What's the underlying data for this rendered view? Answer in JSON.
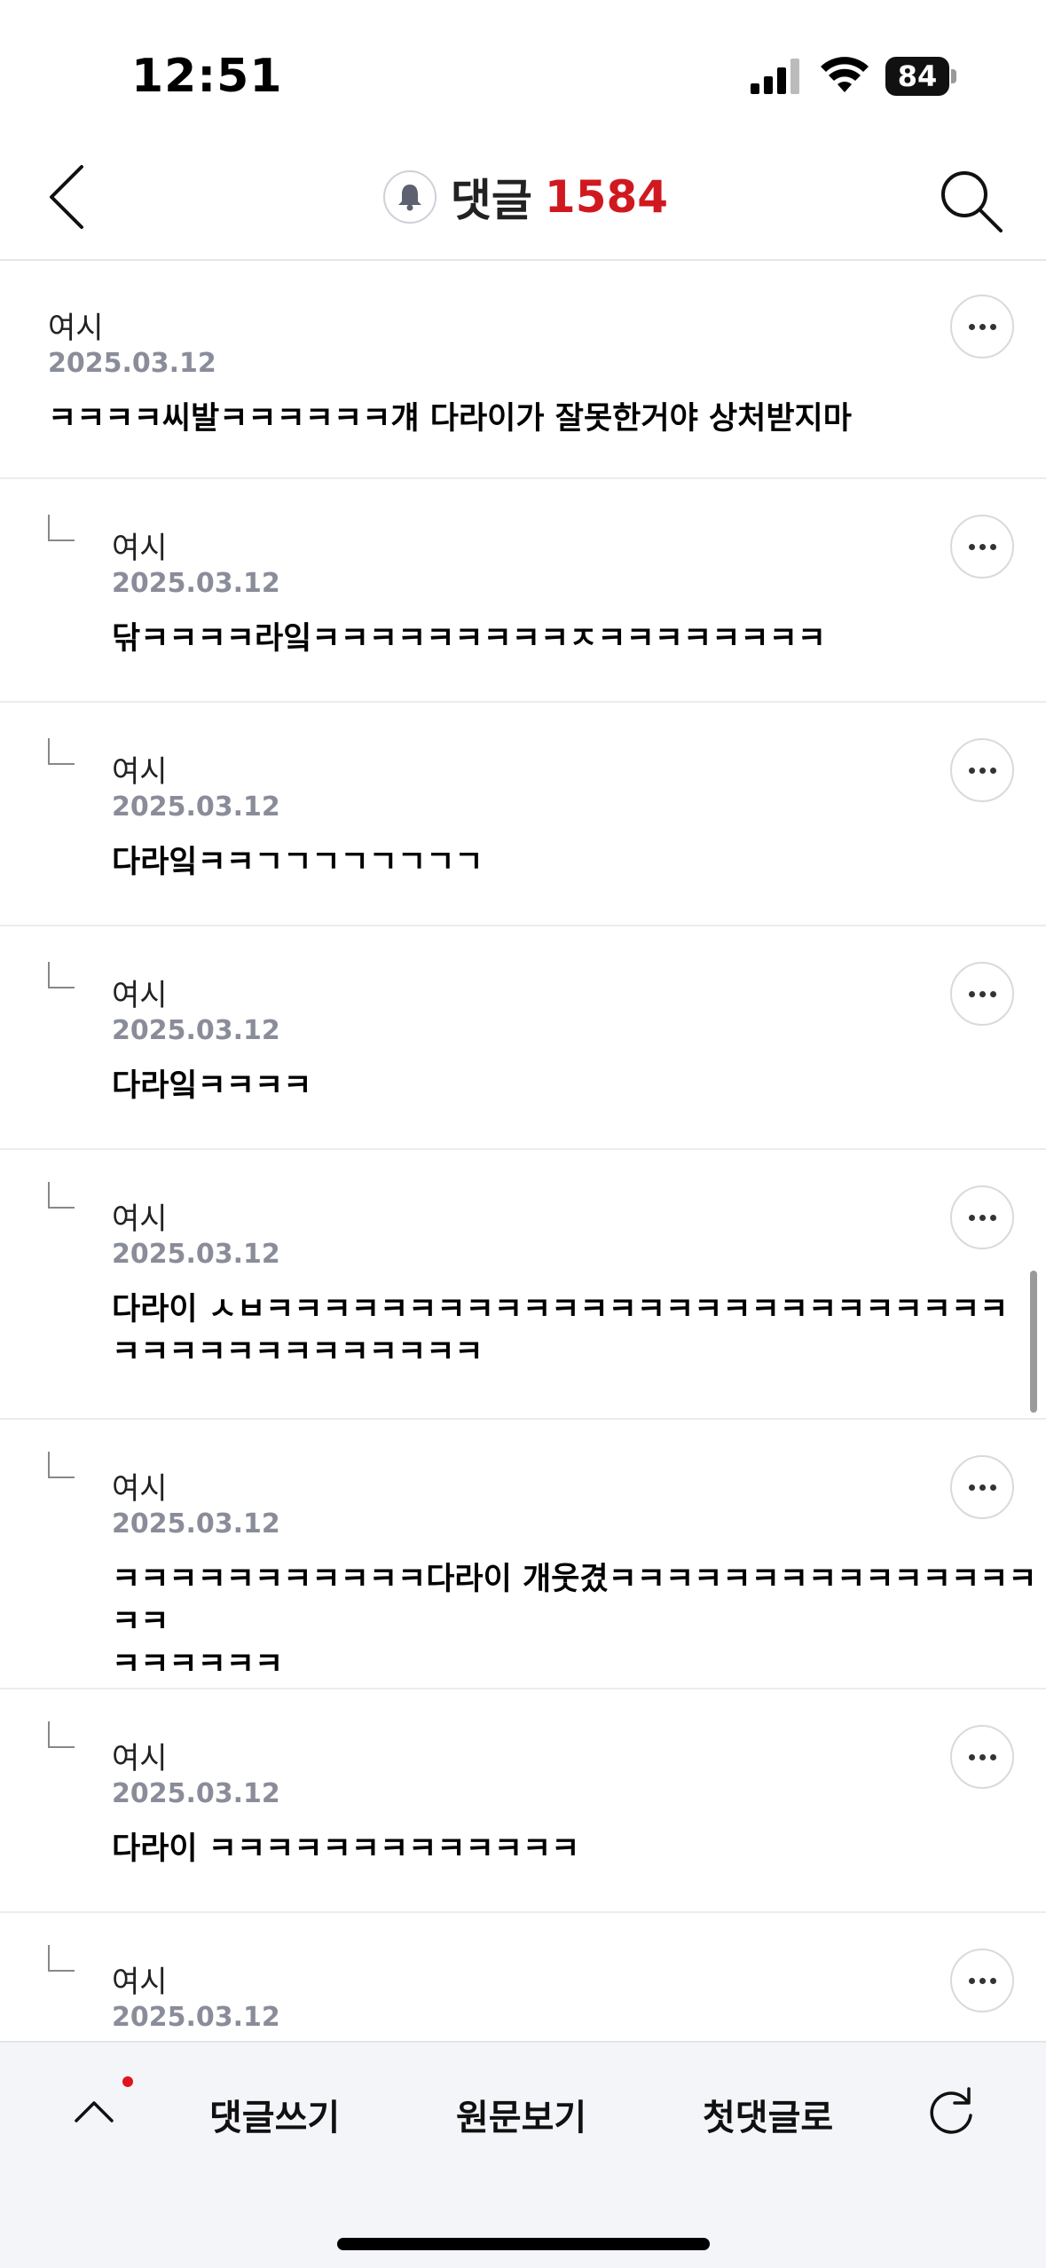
{
  "status_bar": {
    "time": "12:51",
    "battery": "84",
    "icons": [
      "signal-icon",
      "wifi-icon",
      "battery-icon"
    ]
  },
  "header": {
    "title": "댓글",
    "count": "1584",
    "count_color": "#d0191f",
    "icons": [
      "back-arrow-icon",
      "bell-icon",
      "search-icon"
    ]
  },
  "comments": [
    {
      "author": "여시",
      "date": "2025.03.12",
      "lines": [
        "ㅋㅋㅋㅋ씨발ㅋㅋㅋㅋㅋㅋ걔 다라이가 잘못한거야 상처받지마"
      ],
      "reply": false
    },
    {
      "author": "여시",
      "date": "2025.03.12",
      "lines": [
        "닦ㅋㅋㅋㅋ라잌ㅋㅋㅋㅋㅋㅋㅋㅋㅋㅈㅋㅋㅋㅋㅋㅋㅋㅋ"
      ],
      "reply": true
    },
    {
      "author": "여시",
      "date": "2025.03.12",
      "lines": [
        "다라잌ㅋㅋㄱㄱㄱㄱㄱㄱㄱㄱ"
      ],
      "reply": true
    },
    {
      "author": "여시",
      "date": "2025.03.12",
      "lines": [
        "다라잌ㅋㅋㅋㅋ"
      ],
      "reply": true
    },
    {
      "author": "여시",
      "date": "2025.03.12",
      "lines": [
        "다라이 ㅅㅂㅋㅋㅋㅋㅋㅋㅋㅋㅋㅋㅋㅋㅋㅋㅋㅋㅋㅋㅋㅋㅋㅋㅋㅋㅋㅋ",
        "ㅋㅋㅋㅋㅋㅋㅋㅋㅋㅋㅋㅋㅋ"
      ],
      "reply": true
    },
    {
      "author": "여시",
      "date": "2025.03.12",
      "lines": [
        "ㅋㅋㅋㅋㅋㅋㅋㅋㅋㅋㅋ다라이 개웃겼ㅋㅋㅋㅋㅋㅋㅋㅋㅋㅋㅋㅋㅋㅋㅋㅋㅋ",
        "ㅋㅋㅋㅋㅋㅋ"
      ],
      "reply": true
    },
    {
      "author": "여시",
      "date": "2025.03.12",
      "lines": [
        "다라이 ㅋㅋㅋㅋㅋㅋㅋㅋㅋㅋㅋㅋㅋ"
      ],
      "reply": true
    },
    {
      "author": "여시",
      "date": "2025.03.12",
      "lines": [],
      "reply": true
    }
  ],
  "bottom_bar": {
    "write_comment": "댓글쓰기",
    "view_original": "원문보기",
    "first_comment": "첫댓글로",
    "icons": [
      "chevron-up-icon",
      "refresh-icon"
    ],
    "dot_color": "#e0141c"
  }
}
